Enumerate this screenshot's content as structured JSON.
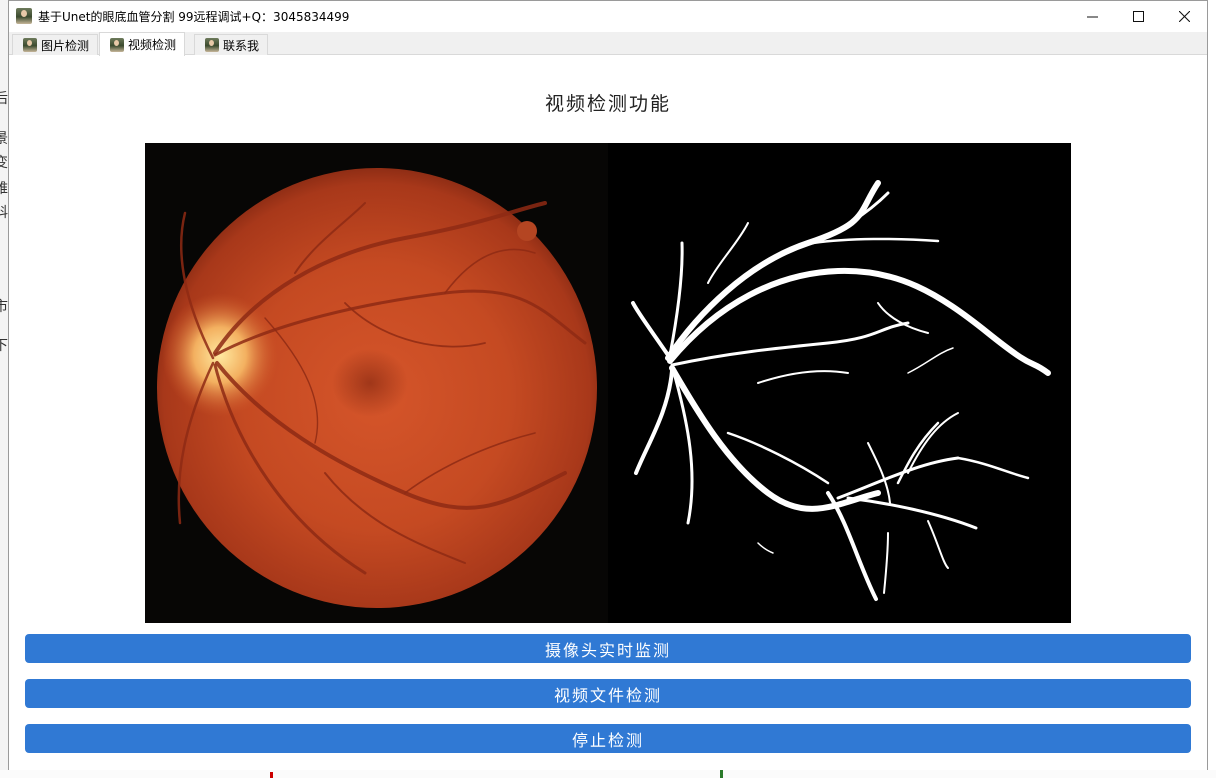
{
  "window": {
    "title": "基于Unet的眼底血管分割 99远程调试+Q：3045834499"
  },
  "tabs": [
    {
      "label": "图片检测",
      "icon": "app-thumbnail-icon",
      "active": false
    },
    {
      "label": "视频检测",
      "icon": "app-thumbnail-icon",
      "active": true
    },
    {
      "label": "联系我",
      "icon": "app-thumbnail-icon",
      "active": false
    }
  ],
  "page": {
    "title": "视频检测功能"
  },
  "buttons": {
    "camera": "摄像头实时监测",
    "video_file": "视频文件检测",
    "stop": "停止检测"
  },
  "colors": {
    "accent": "#3079d4",
    "display_bg": "#000000"
  }
}
